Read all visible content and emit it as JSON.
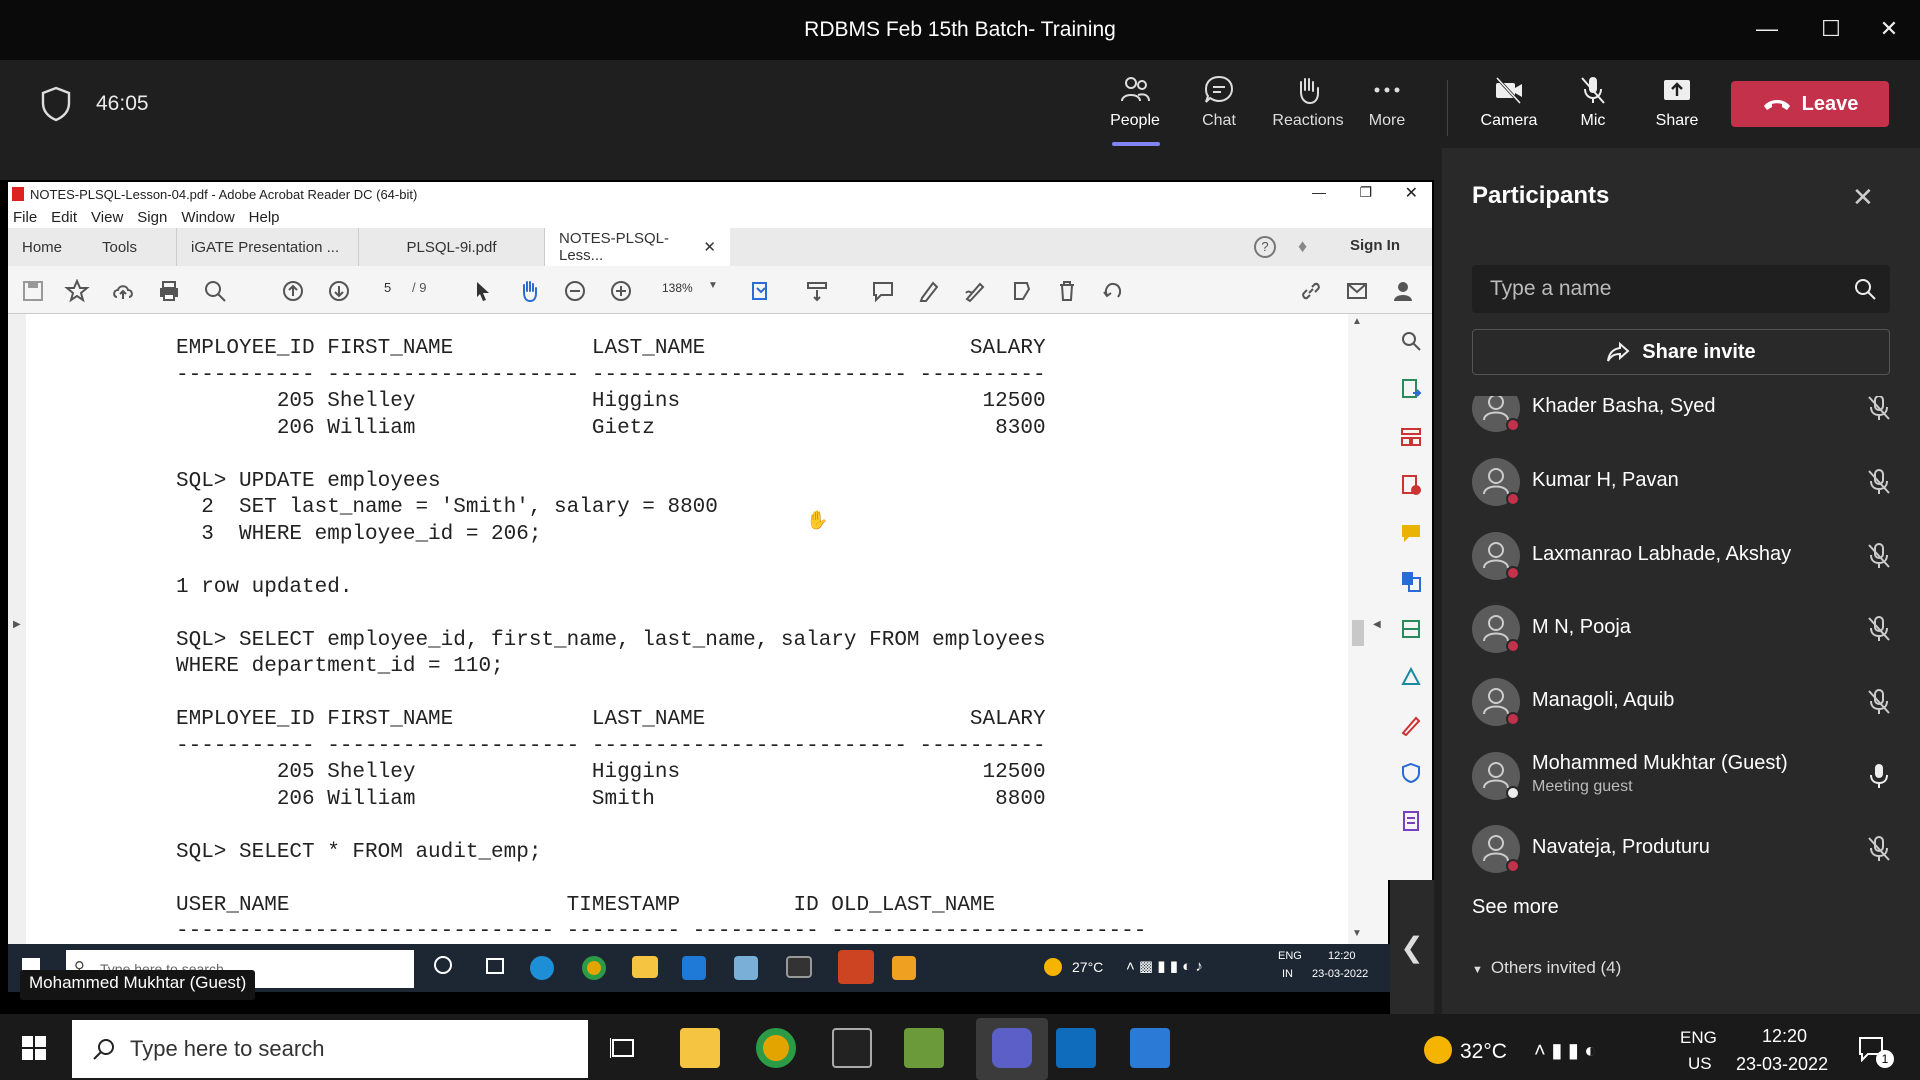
{
  "meeting": {
    "title": "RDBMS Feb 15th Batch- Training",
    "timer": "46:05",
    "buttons": {
      "people": "People",
      "chat": "Chat",
      "reactions": "Reactions",
      "more": "More",
      "camera": "Camera",
      "mic": "Mic",
      "share": "Share",
      "leave": "Leave"
    }
  },
  "acrobat": {
    "title": "NOTES-PLSQL-Lesson-04.pdf - Adobe Acrobat Reader DC (64-bit)",
    "menu": [
      "File",
      "Edit",
      "View",
      "Sign",
      "Window",
      "Help"
    ],
    "tabs": {
      "home": "Home",
      "tools": "Tools",
      "t1": "iGATE Presentation ...",
      "t2": "PLSQL-9i.pdf",
      "t3": "NOTES-PLSQL-Less..."
    },
    "sign_in": "Sign In",
    "page": "5",
    "page_total": "/ 9",
    "zoom": "138%",
    "pdf_lines": [
      "EMPLOYEE_ID FIRST_NAME           LAST_NAME                     SALARY",
      "----------- -------------------- ------------------------- ----------",
      "        205 Shelley              Higgins                        12500",
      "        206 William              Gietz                           8300",
      "",
      "SQL> UPDATE employees",
      "  2  SET last_name = 'Smith', salary = 8800",
      "  3  WHERE employee_id = 206;",
      "",
      "1 row updated.",
      "",
      "SQL> SELECT employee_id, first_name, last_name, salary FROM employees",
      "WHERE department_id = 110;",
      "",
      "EMPLOYEE_ID FIRST_NAME           LAST_NAME                     SALARY",
      "----------- -------------------- ------------------------- ----------",
      "        205 Shelley              Higgins                        12500",
      "        206 William              Smith                           8800",
      "",
      "SQL> SELECT * FROM audit_emp;",
      "",
      "USER_NAME                      TIMESTAMP         ID OLD_LAST_NAME",
      "------------------------------ --------- ---------- -------------------------"
    ]
  },
  "inner_taskbar": {
    "search": "Type here to search",
    "weather": "27°C",
    "lang1": "ENG",
    "lang2": "IN",
    "time": "12:20",
    "date": "23-03-2022"
  },
  "video_label": "Mohammed Mukhtar (Guest)",
  "participants": {
    "title": "Participants",
    "search_placeholder": "Type a name",
    "share_invite": "Share invite",
    "list": [
      {
        "name": "Khader Basha, Syed",
        "sub": "",
        "muted": true
      },
      {
        "name": "Kumar H, Pavan",
        "sub": "",
        "muted": true
      },
      {
        "name": "Laxmanrao Labhade, Akshay",
        "sub": "",
        "muted": true
      },
      {
        "name": "M N, Pooja",
        "sub": "",
        "muted": true
      },
      {
        "name": "Managoli, Aquib",
        "sub": "",
        "muted": true
      },
      {
        "name": "Mohammed Mukhtar (Guest)",
        "sub": "Meeting guest",
        "muted": false
      },
      {
        "name": "Navateja, Produturu",
        "sub": "",
        "muted": true
      }
    ],
    "see_more": "See more",
    "others": "Others invited (4)"
  },
  "taskbar": {
    "search": "Type here to search",
    "weather": "32°C",
    "lang1": "ENG",
    "lang2": "US",
    "time": "12:20",
    "date": "23-03-2022",
    "notif": "1"
  }
}
